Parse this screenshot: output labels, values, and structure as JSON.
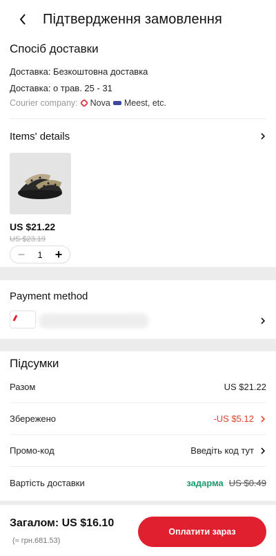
{
  "header": {
    "title": "Підтвердження замовлення",
    "back_icon": "chevron-left-icon"
  },
  "delivery": {
    "section_title": "Спосіб доставки",
    "method": "Доставка: Безкоштовна доставка",
    "date": "Доставка: о трав. 25 - 31",
    "courier_label": "Courier company:",
    "carrier_1": "Nova",
    "carrier_2": "Meest, etc."
  },
  "items": {
    "title": "Items' details",
    "product": {
      "price": "US $21.22",
      "old_price": "US $23.19",
      "quantity": "1",
      "minus": "−",
      "plus": "+"
    }
  },
  "payment": {
    "title": "Payment method"
  },
  "summary": {
    "title": "Підсумки",
    "rows": {
      "subtotal": {
        "label": "Разом",
        "value": "US $21.22"
      },
      "saved": {
        "label": "Збережено",
        "value": "-US $5.12"
      },
      "promo": {
        "label": "Промо-код",
        "value": "Введіть код тут"
      },
      "shipping": {
        "label": "Вартість доставки",
        "free": "задарма",
        "old": "US $0.49"
      }
    }
  },
  "footer": {
    "total": "Загалом:  US $16.10",
    "total_uah": "(≈ грн.681.53)",
    "pay_button": "Оплатити зараз"
  },
  "colors": {
    "accent": "#e0202f",
    "saved": "#e0432c",
    "free": "#1a9b6c"
  }
}
